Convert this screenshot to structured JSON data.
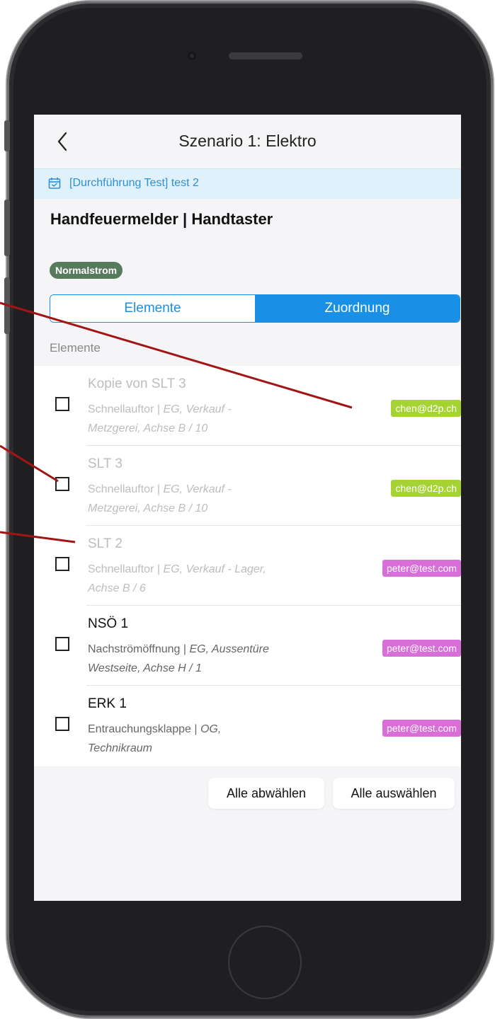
{
  "nav": {
    "title": "Szenario 1: Elektro",
    "back_icon": "chevron-left-icon"
  },
  "banner": {
    "icon": "calendar-icon",
    "text": "[Durchführung Test] test 2",
    "color": "#2f8fd6"
  },
  "heading": "Handfeuermelder | Handtaster",
  "badge": "Normalstrom",
  "segments": {
    "left": "Elemente",
    "right": "Zuordnung",
    "selected": "Zuordnung"
  },
  "section_label": "Elemente",
  "items": [
    {
      "title": "Kopie von SLT 3",
      "type": "Schnellauftor",
      "sep": " | ",
      "location_1": "EG, Verkauf -",
      "location_2": "Metzgerei, Achse B / 10",
      "assignee": "chen@d2p.ch",
      "checked": false
    },
    {
      "title": "SLT 3",
      "type": "Schnellauftor",
      "sep": " | ",
      "location_1": "EG, Verkauf -",
      "location_2": "Metzgerei, Achse B / 10",
      "assignee": "chen@d2p.ch",
      "checked": false
    },
    {
      "title": "SLT 2",
      "type": "Schnellauftor",
      "sep": " | ",
      "location_1": "EG, Verkauf - Lager,",
      "location_2": "Achse B / 6",
      "assignee": "peter@test.com",
      "checked": false
    },
    {
      "title": "NSÖ 1",
      "type": "Nachströmöffnung",
      "sep": " | ",
      "location_1": "EG, Aussentüre",
      "location_2": "Westseite, Achse H / 1",
      "assignee": "peter@test.com",
      "checked": false
    },
    {
      "title": "ERK 1",
      "type": "Entrauchungsklappe",
      "sep": " | ",
      "location_1": "OG,",
      "location_2": "Technikraum",
      "assignee": "peter@test.com",
      "checked": false
    }
  ],
  "buttons": {
    "deselect_all": "Alle abwählen",
    "select_all": "Alle auswählen"
  },
  "colors": {
    "accent": "#1a8fe6",
    "badge": "#557a5c",
    "tag_green": "#a6d334",
    "tag_pink": "#d86ed8",
    "annotation_line": "#a31515"
  }
}
